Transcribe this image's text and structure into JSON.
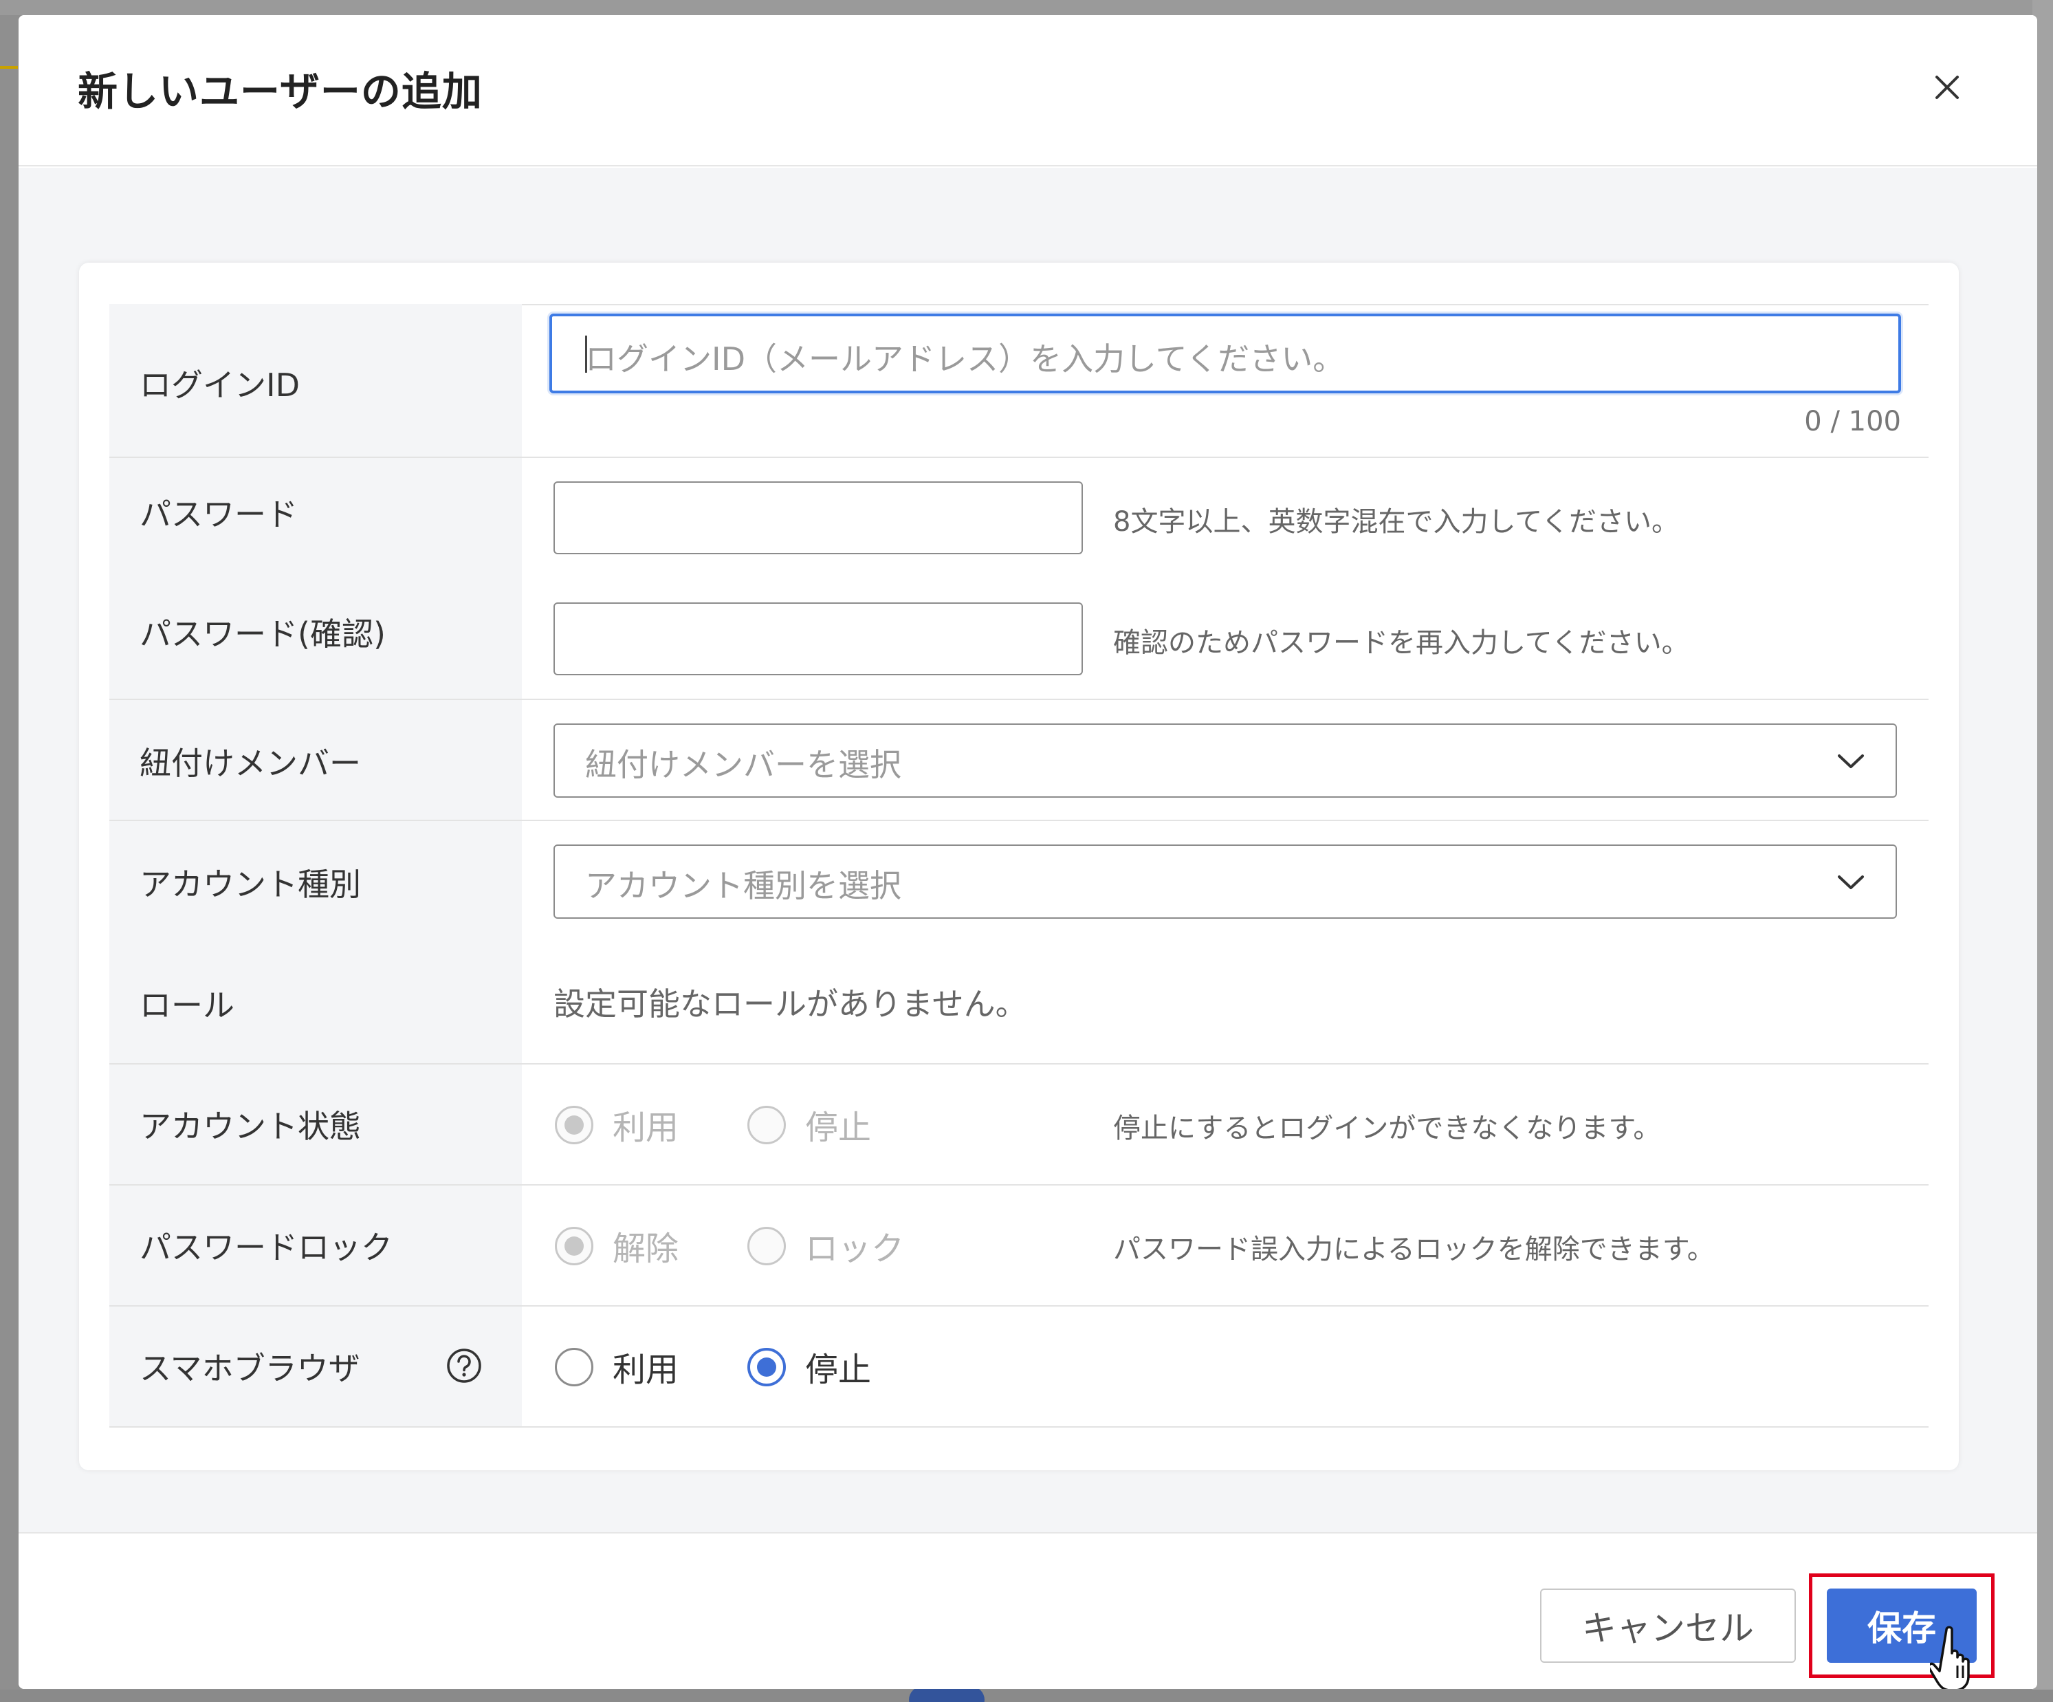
{
  "dialog": {
    "title": "新しいユーザーの追加"
  },
  "form": {
    "login_id": {
      "label": "ログインID",
      "placeholder": "ログインID（メールアドレス）を入力してください。",
      "counter": "0 / 100"
    },
    "password": {
      "label": "パスワード",
      "hint": "8文字以上、英数字混在で入力してください。"
    },
    "password_confirm": {
      "label": "パスワード(確認)",
      "hint": "確認のためパスワードを再入力してください。"
    },
    "member": {
      "label": "紐付けメンバー",
      "placeholder": "紐付けメンバーを選択"
    },
    "account_type": {
      "label": "アカウント種別",
      "placeholder": "アカウント種別を選択"
    },
    "role": {
      "label": "ロール",
      "message": "設定可能なロールがありません。"
    },
    "account_status": {
      "label": "アカウント状態",
      "options": [
        "利用",
        "停止"
      ],
      "selected": "利用",
      "disabled": true,
      "hint": "停止にするとログインができなくなります。"
    },
    "password_lock": {
      "label": "パスワードロック",
      "options": [
        "解除",
        "ロック"
      ],
      "selected": "解除",
      "disabled": true,
      "hint": "パスワード誤入力によるロックを解除できます。"
    },
    "mobile_browser": {
      "label": "スマホブラウザ",
      "options": [
        "利用",
        "停止"
      ],
      "selected": "停止",
      "disabled": false
    }
  },
  "footer": {
    "cancel_label": "キャンセル",
    "save_label": "保存"
  },
  "colors": {
    "primary": "#3d6fd8",
    "focus_border": "#3e7be5",
    "highlight_frame": "#e0001b"
  }
}
